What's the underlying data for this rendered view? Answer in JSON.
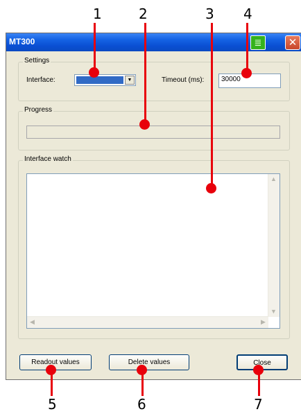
{
  "window": {
    "title": "MT300",
    "close_glyph": "✕",
    "app_icon": "chart-icon"
  },
  "settings": {
    "group_label": "Settings",
    "interface_label": "Interface:",
    "interface_value": "",
    "timeout_label": "Timeout (ms):",
    "timeout_value": "30000"
  },
  "progress": {
    "group_label": "Progress",
    "value": 0
  },
  "watch": {
    "group_label": "Interface watch",
    "content": ""
  },
  "buttons": {
    "readout": "Readout values",
    "delete": "Delete values",
    "close": "Close"
  },
  "callouts": [
    "1",
    "2",
    "3",
    "4",
    "5",
    "6",
    "7"
  ],
  "colors": {
    "callout": "#e8000b",
    "titlebar": "#0a4fd3",
    "dialog_bg": "#ece9d8"
  }
}
